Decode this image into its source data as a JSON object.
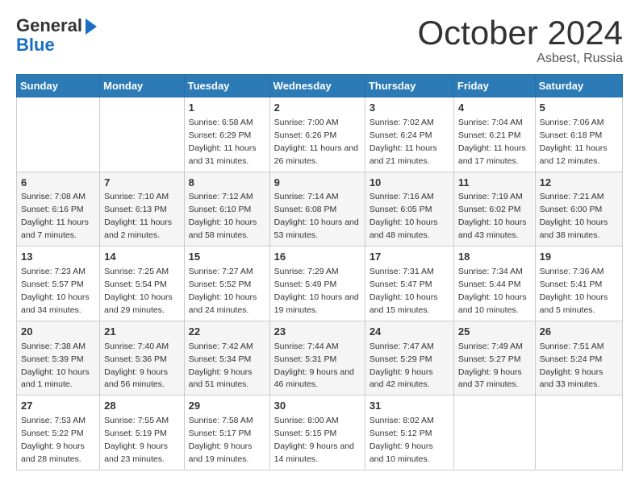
{
  "header": {
    "logo_line1": "General",
    "logo_line2": "Blue",
    "month_title": "October 2024",
    "location": "Asbest, Russia"
  },
  "weekdays": [
    "Sunday",
    "Monday",
    "Tuesday",
    "Wednesday",
    "Thursday",
    "Friday",
    "Saturday"
  ],
  "weeks": [
    [
      {
        "day": "",
        "info": ""
      },
      {
        "day": "",
        "info": ""
      },
      {
        "day": "1",
        "info": "Sunrise: 6:58 AM\nSunset: 6:29 PM\nDaylight: 11 hours and 31 minutes."
      },
      {
        "day": "2",
        "info": "Sunrise: 7:00 AM\nSunset: 6:26 PM\nDaylight: 11 hours and 26 minutes."
      },
      {
        "day": "3",
        "info": "Sunrise: 7:02 AM\nSunset: 6:24 PM\nDaylight: 11 hours and 21 minutes."
      },
      {
        "day": "4",
        "info": "Sunrise: 7:04 AM\nSunset: 6:21 PM\nDaylight: 11 hours and 17 minutes."
      },
      {
        "day": "5",
        "info": "Sunrise: 7:06 AM\nSunset: 6:18 PM\nDaylight: 11 hours and 12 minutes."
      }
    ],
    [
      {
        "day": "6",
        "info": "Sunrise: 7:08 AM\nSunset: 6:16 PM\nDaylight: 11 hours and 7 minutes."
      },
      {
        "day": "7",
        "info": "Sunrise: 7:10 AM\nSunset: 6:13 PM\nDaylight: 11 hours and 2 minutes."
      },
      {
        "day": "8",
        "info": "Sunrise: 7:12 AM\nSunset: 6:10 PM\nDaylight: 10 hours and 58 minutes."
      },
      {
        "day": "9",
        "info": "Sunrise: 7:14 AM\nSunset: 6:08 PM\nDaylight: 10 hours and 53 minutes."
      },
      {
        "day": "10",
        "info": "Sunrise: 7:16 AM\nSunset: 6:05 PM\nDaylight: 10 hours and 48 minutes."
      },
      {
        "day": "11",
        "info": "Sunrise: 7:19 AM\nSunset: 6:02 PM\nDaylight: 10 hours and 43 minutes."
      },
      {
        "day": "12",
        "info": "Sunrise: 7:21 AM\nSunset: 6:00 PM\nDaylight: 10 hours and 38 minutes."
      }
    ],
    [
      {
        "day": "13",
        "info": "Sunrise: 7:23 AM\nSunset: 5:57 PM\nDaylight: 10 hours and 34 minutes."
      },
      {
        "day": "14",
        "info": "Sunrise: 7:25 AM\nSunset: 5:54 PM\nDaylight: 10 hours and 29 minutes."
      },
      {
        "day": "15",
        "info": "Sunrise: 7:27 AM\nSunset: 5:52 PM\nDaylight: 10 hours and 24 minutes."
      },
      {
        "day": "16",
        "info": "Sunrise: 7:29 AM\nSunset: 5:49 PM\nDaylight: 10 hours and 19 minutes."
      },
      {
        "day": "17",
        "info": "Sunrise: 7:31 AM\nSunset: 5:47 PM\nDaylight: 10 hours and 15 minutes."
      },
      {
        "day": "18",
        "info": "Sunrise: 7:34 AM\nSunset: 5:44 PM\nDaylight: 10 hours and 10 minutes."
      },
      {
        "day": "19",
        "info": "Sunrise: 7:36 AM\nSunset: 5:41 PM\nDaylight: 10 hours and 5 minutes."
      }
    ],
    [
      {
        "day": "20",
        "info": "Sunrise: 7:38 AM\nSunset: 5:39 PM\nDaylight: 10 hours and 1 minute."
      },
      {
        "day": "21",
        "info": "Sunrise: 7:40 AM\nSunset: 5:36 PM\nDaylight: 9 hours and 56 minutes."
      },
      {
        "day": "22",
        "info": "Sunrise: 7:42 AM\nSunset: 5:34 PM\nDaylight: 9 hours and 51 minutes."
      },
      {
        "day": "23",
        "info": "Sunrise: 7:44 AM\nSunset: 5:31 PM\nDaylight: 9 hours and 46 minutes."
      },
      {
        "day": "24",
        "info": "Sunrise: 7:47 AM\nSunset: 5:29 PM\nDaylight: 9 hours and 42 minutes."
      },
      {
        "day": "25",
        "info": "Sunrise: 7:49 AM\nSunset: 5:27 PM\nDaylight: 9 hours and 37 minutes."
      },
      {
        "day": "26",
        "info": "Sunrise: 7:51 AM\nSunset: 5:24 PM\nDaylight: 9 hours and 33 minutes."
      }
    ],
    [
      {
        "day": "27",
        "info": "Sunrise: 7:53 AM\nSunset: 5:22 PM\nDaylight: 9 hours and 28 minutes."
      },
      {
        "day": "28",
        "info": "Sunrise: 7:55 AM\nSunset: 5:19 PM\nDaylight: 9 hours and 23 minutes."
      },
      {
        "day": "29",
        "info": "Sunrise: 7:58 AM\nSunset: 5:17 PM\nDaylight: 9 hours and 19 minutes."
      },
      {
        "day": "30",
        "info": "Sunrise: 8:00 AM\nSunset: 5:15 PM\nDaylight: 9 hours and 14 minutes."
      },
      {
        "day": "31",
        "info": "Sunrise: 8:02 AM\nSunset: 5:12 PM\nDaylight: 9 hours and 10 minutes."
      },
      {
        "day": "",
        "info": ""
      },
      {
        "day": "",
        "info": ""
      }
    ]
  ]
}
